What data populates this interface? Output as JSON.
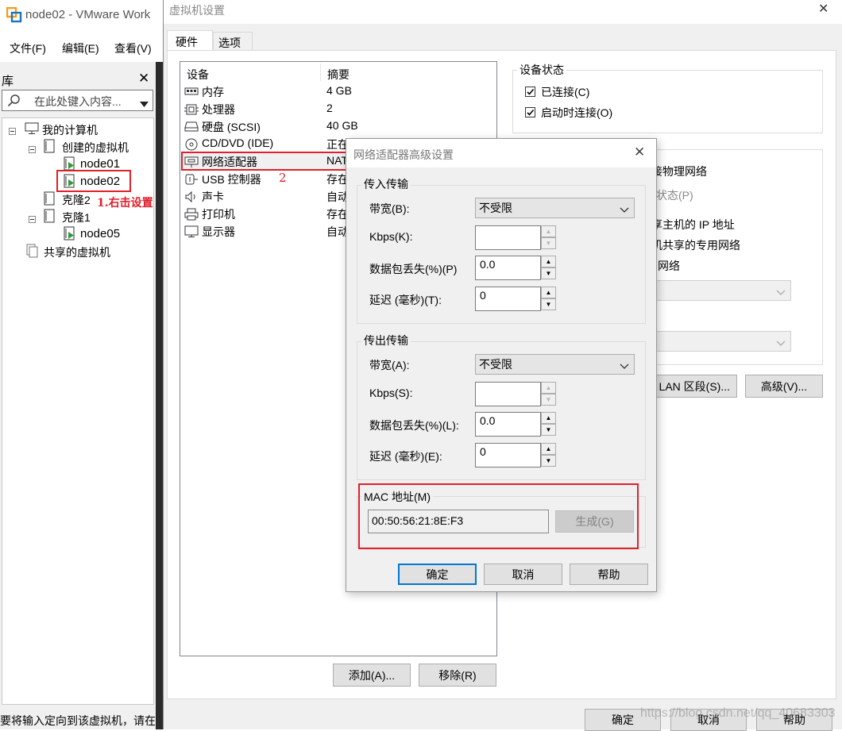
{
  "app": {
    "title": "node02 - VMware Work",
    "menu": [
      "文件(F)",
      "编辑(E)",
      "查看(V)"
    ]
  },
  "library": {
    "title": "库",
    "search_placeholder": "在此处键入内容...",
    "tree": {
      "root": "我的计算机",
      "group1": "创建的虚拟机",
      "vm1": "node01",
      "vm2": "node02",
      "clone2": "克隆2",
      "clone1": "克隆1",
      "vm5": "node05",
      "shared": "共享的虚拟机"
    },
    "annotation1": "1.右击设置"
  },
  "status_bar": "要将输入定向到该虚拟机，请在",
  "settings": {
    "title": "虚拟机设置",
    "tabs": [
      "硬件",
      "选项"
    ],
    "columns": [
      "设备",
      "摘要"
    ],
    "devices": [
      {
        "icon": "memory-icon",
        "name": "内存",
        "summary": "4 GB"
      },
      {
        "icon": "cpu-icon",
        "name": "处理器",
        "summary": "2"
      },
      {
        "icon": "hard-disk-icon",
        "name": "硬盘 (SCSI)",
        "summary": "40 GB"
      },
      {
        "icon": "cd-dvd-icon",
        "name": "CD/DVD (IDE)",
        "summary": "正在"
      },
      {
        "icon": "network-adapter-icon",
        "name": "网络适配器",
        "summary": "NAT"
      },
      {
        "icon": "usb-icon",
        "name": "USB 控制器",
        "summary": "存在"
      },
      {
        "icon": "sound-icon",
        "name": "声卡",
        "summary": "自动"
      },
      {
        "icon": "printer-icon",
        "name": "打印机",
        "summary": "存在"
      },
      {
        "icon": "display-icon",
        "name": "显示器",
        "summary": "自动"
      }
    ],
    "annotation2": "2",
    "add_button": "添加(A)...",
    "remove_button": "移除(R)",
    "device_status": {
      "title": "设备状态",
      "connected": "已连接(C)",
      "connect_at_power_on": "启动时连接(O)"
    },
    "network_partial": {
      "bridged": "接物理网络",
      "replicate": "状态(P)",
      "nat": "享主机的 IP 地址",
      "host_only": "机共享的专用网络",
      "custom": "网络"
    },
    "lan_segments_button": "LAN 区段(S)...",
    "advanced_button": "高级(V)...",
    "ok": "确定",
    "cancel": "取消",
    "help": "帮助",
    "watermark": "https://blog.csdn.net/qq_40683303"
  },
  "advanced_dialog": {
    "title": "网络适配器高级设置",
    "incoming": {
      "title": "传入传输",
      "bandwidth_label": "带宽(B):",
      "bandwidth_value": "不受限",
      "kbps_label": "Kbps(K):",
      "kbps_value": "",
      "loss_label": "数据包丢失(%)(P)",
      "loss_value": "0.0",
      "latency_label": "延迟 (毫秒)(T):",
      "latency_value": "0"
    },
    "outgoing": {
      "title": "传出传输",
      "bandwidth_label": "带宽(A):",
      "bandwidth_value": "不受限",
      "kbps_label": "Kbps(S):",
      "kbps_value": "",
      "loss_label": "数据包丢失(%)(L):",
      "loss_value": "0.0",
      "latency_label": "延迟 (毫秒)(E):",
      "latency_value": "0"
    },
    "mac": {
      "title": "MAC 地址(M)",
      "value": "00:50:56:21:8E:F3",
      "generate": "生成(G)"
    },
    "ok": "确定",
    "cancel": "取消",
    "help": "帮助"
  },
  "colors": {
    "highlight_red": "#e0202a",
    "accent_blue": "#0078d7",
    "play_green": "#2e9a3e"
  }
}
